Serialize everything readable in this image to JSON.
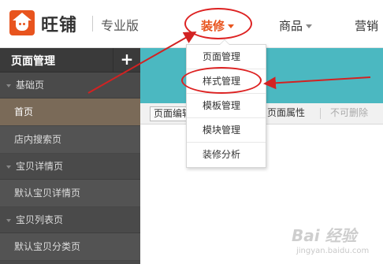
{
  "header": {
    "brand": "旺铺",
    "edition": "专业版",
    "nav": [
      {
        "label": "装修"
      },
      {
        "label": "商品"
      },
      {
        "label": "营销"
      }
    ]
  },
  "sidebar": {
    "title": "页面管理",
    "add": "+",
    "groups": [
      {
        "label": "基础页",
        "items": [
          "首页",
          "店内搜索页"
        ]
      },
      {
        "label": "宝贝详情页",
        "items": [
          "默认宝贝详情页"
        ]
      },
      {
        "label": "宝贝列表页",
        "items": [
          "默认宝贝分类页"
        ]
      }
    ]
  },
  "toolbar": {
    "edit": "页面编辑",
    "props": "页面属性",
    "delete": "不可删除"
  },
  "dropdown": {
    "items": [
      "页面管理",
      "样式管理",
      "模板管理",
      "模块管理",
      "装修分析"
    ]
  },
  "watermark": {
    "text": "Bai 经验",
    "sub": "jingyan.baidu.com"
  },
  "colors": {
    "accent": "#e8541e",
    "annotation": "#d22222",
    "banner": "#4bb8c1",
    "sidebar_bg": "#4a4a4a",
    "active_item": "#7a6a58"
  }
}
